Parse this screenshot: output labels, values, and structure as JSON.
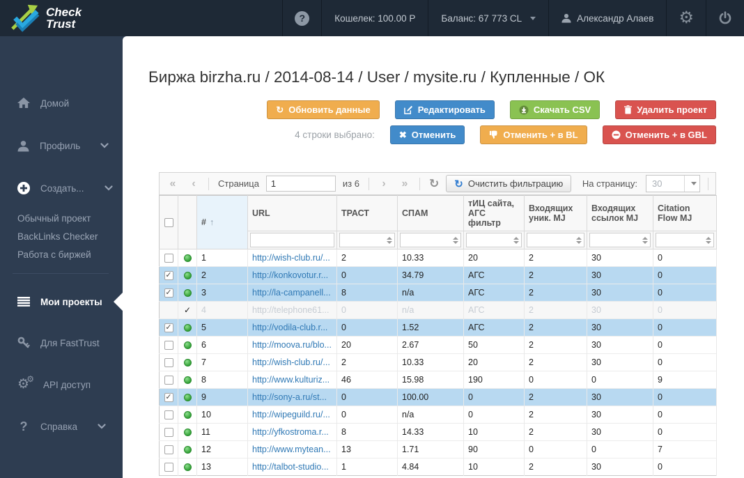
{
  "topbar": {
    "logo_line1": "Check",
    "logo_line2": "Trust",
    "help": "?",
    "wallet": "Кошелек: 100.00 Р",
    "balance": "Баланс: 67 773 CL",
    "user": "Александр Алаев"
  },
  "sidebar": {
    "items": [
      {
        "label": "Домой"
      },
      {
        "label": "Профиль"
      },
      {
        "label": "Создать..."
      }
    ],
    "sub_items": [
      {
        "label": "Обычный проект"
      },
      {
        "label": "BackLinks Checker"
      },
      {
        "label": "Работа с биржей"
      }
    ],
    "items_lower": [
      {
        "label": "Мои проекты"
      },
      {
        "label": "Для FastTrust"
      },
      {
        "label": "API доступ"
      },
      {
        "label": "Справка"
      }
    ]
  },
  "page": {
    "title": "Биржа birzha.ru / 2014-08-14 / User / mysite.ru / Купленные / ОК",
    "actions": [
      {
        "label": "Обновить данные",
        "color": "#f0ad4e"
      },
      {
        "label": "Редактировать",
        "color": "#428bca"
      },
      {
        "label": "Скачать CSV",
        "color": "#8ac252"
      },
      {
        "label": "Удалить проект",
        "color": "#d9534f"
      }
    ],
    "selection_label": "4 строки выбрано:",
    "selection_actions": [
      {
        "label": "Отменить",
        "color": "#428bca"
      },
      {
        "label": "Отменить + в BL",
        "color": "#f0ad4e"
      },
      {
        "label": "Отменить + в GBL",
        "color": "#d9534f"
      }
    ]
  },
  "pager": {
    "page_label": "Страница",
    "page_value": "1",
    "of_label": "из 6",
    "clear_filter_label": "Очистить фильтрацию",
    "per_page_label": "На страницу:",
    "per_page_value": "30"
  },
  "table": {
    "columns": [
      {
        "label": "#",
        "sorted": "asc"
      },
      {
        "label": "URL"
      },
      {
        "label": "ТРАСТ"
      },
      {
        "label": "СПАМ"
      },
      {
        "label": "тИЦ сайта, АГС фильтр"
      },
      {
        "label": "Входящих уник. MJ"
      },
      {
        "label": "Входящих ссылок MJ"
      },
      {
        "label": "Citation Flow MJ"
      }
    ],
    "rows": [
      {
        "num": "1",
        "checked": false,
        "selected": false,
        "cancelled": false,
        "url": "http://wish-club.ru/...",
        "trust": {
          "v": "2",
          "c": "red"
        },
        "spam": {
          "v": "10.33",
          "c": "orange"
        },
        "tic": {
          "v": "20",
          "c": "dark"
        },
        "mj_unique": "2",
        "mj_links": "30",
        "citation_flow": "0"
      },
      {
        "num": "2",
        "checked": true,
        "selected": true,
        "cancelled": false,
        "url": "http://konkovotur.r...",
        "trust": {
          "v": "0",
          "c": "red"
        },
        "spam": {
          "v": "34.79",
          "c": "red"
        },
        "tic": {
          "v": "АГС",
          "c": "red"
        },
        "mj_unique": "2",
        "mj_links": "30",
        "citation_flow": "0"
      },
      {
        "num": "3",
        "checked": true,
        "selected": true,
        "cancelled": false,
        "url": "http://la-campanell...",
        "trust": {
          "v": "8",
          "c": "red"
        },
        "spam": {
          "v": "n/a",
          "c": "muted"
        },
        "tic": {
          "v": "АГС",
          "c": "red"
        },
        "mj_unique": "2",
        "mj_links": "30",
        "citation_flow": "0"
      },
      {
        "num": "4",
        "checked": false,
        "selected": false,
        "cancelled": true,
        "url": "http://telephone61...",
        "trust": {
          "v": "0",
          "c": "muted"
        },
        "spam": {
          "v": "n/a",
          "c": "muted"
        },
        "tic": {
          "v": "АГС",
          "c": "muted"
        },
        "mj_unique": "2",
        "mj_links": "30",
        "citation_flow": "0"
      },
      {
        "num": "5",
        "checked": true,
        "selected": true,
        "cancelled": false,
        "url": "http://vodila-club.r...",
        "trust": {
          "v": "0",
          "c": "red"
        },
        "spam": {
          "v": "1.52",
          "c": "green"
        },
        "tic": {
          "v": "АГС",
          "c": "red"
        },
        "mj_unique": "2",
        "mj_links": "30",
        "citation_flow": "0"
      },
      {
        "num": "6",
        "checked": false,
        "selected": false,
        "cancelled": false,
        "url": "http://moova.ru/blo...",
        "trust": {
          "v": "20",
          "c": "red"
        },
        "spam": {
          "v": "2.67",
          "c": "green"
        },
        "tic": {
          "v": "50",
          "c": "dark"
        },
        "mj_unique": "2",
        "mj_links": "30",
        "citation_flow": "0"
      },
      {
        "num": "7",
        "checked": false,
        "selected": false,
        "cancelled": false,
        "url": "http://wish-club.ru/...",
        "trust": {
          "v": "2",
          "c": "red"
        },
        "spam": {
          "v": "10.33",
          "c": "orange"
        },
        "tic": {
          "v": "20",
          "c": "dark"
        },
        "mj_unique": "2",
        "mj_links": "30",
        "citation_flow": "0"
      },
      {
        "num": "8",
        "checked": false,
        "selected": false,
        "cancelled": false,
        "url": "http://www.kulturiz...",
        "trust": {
          "v": "46",
          "c": "orange"
        },
        "spam": {
          "v": "15.98",
          "c": "red"
        },
        "tic": {
          "v": "190",
          "c": "dark"
        },
        "mj_unique": "0",
        "mj_links": "0",
        "citation_flow": "9"
      },
      {
        "num": "9",
        "checked": true,
        "selected": true,
        "cancelled": false,
        "url": "http://sony-a.ru/st...",
        "trust": {
          "v": "0",
          "c": "red"
        },
        "spam": {
          "v": "100.00",
          "c": "red"
        },
        "tic": {
          "v": "0",
          "c": "dark"
        },
        "mj_unique": "2",
        "mj_links": "30",
        "citation_flow": "0"
      },
      {
        "num": "10",
        "checked": false,
        "selected": false,
        "cancelled": false,
        "url": "http://wipeguild.ru/...",
        "trust": {
          "v": "0",
          "c": "red"
        },
        "spam": {
          "v": "n/a",
          "c": "muted"
        },
        "tic": {
          "v": "0",
          "c": "dark"
        },
        "mj_unique": "2",
        "mj_links": "30",
        "citation_flow": "0"
      },
      {
        "num": "11",
        "checked": false,
        "selected": false,
        "cancelled": false,
        "url": "http://yfkostroma.r...",
        "trust": {
          "v": "8",
          "c": "red"
        },
        "spam": {
          "v": "14.33",
          "c": "red"
        },
        "tic": {
          "v": "10",
          "c": "dark"
        },
        "mj_unique": "2",
        "mj_links": "30",
        "citation_flow": "0"
      },
      {
        "num": "12",
        "checked": false,
        "selected": false,
        "cancelled": false,
        "url": "http://www.mytean...",
        "trust": {
          "v": "13",
          "c": "red"
        },
        "spam": {
          "v": "1.71",
          "c": "green"
        },
        "tic": {
          "v": "90",
          "c": "dark"
        },
        "mj_unique": "0",
        "mj_links": "0",
        "citation_flow": "7"
      },
      {
        "num": "13",
        "checked": false,
        "selected": false,
        "cancelled": false,
        "url": "http://talbot-studio...",
        "trust": {
          "v": "1",
          "c": "red"
        },
        "spam": {
          "v": "4.84",
          "c": "green"
        },
        "tic": {
          "v": "10",
          "c": "dark"
        },
        "mj_unique": "2",
        "mj_links": "30",
        "citation_flow": "0"
      }
    ]
  },
  "colors": {
    "topbar_bg": "#1e2936",
    "sidebar_bg": "#2e3d51",
    "accent_orange": "#f0ad4e",
    "accent_blue": "#428bca",
    "accent_green": "#8ac252",
    "accent_red": "#d9534f",
    "value_red": "#e8112d",
    "value_orange": "#f0a030",
    "value_green": "#2e9e2e",
    "value_muted": "#c9ced4",
    "link_blue": "#3079b5",
    "selected_row_bg": "#b8d9f1"
  }
}
